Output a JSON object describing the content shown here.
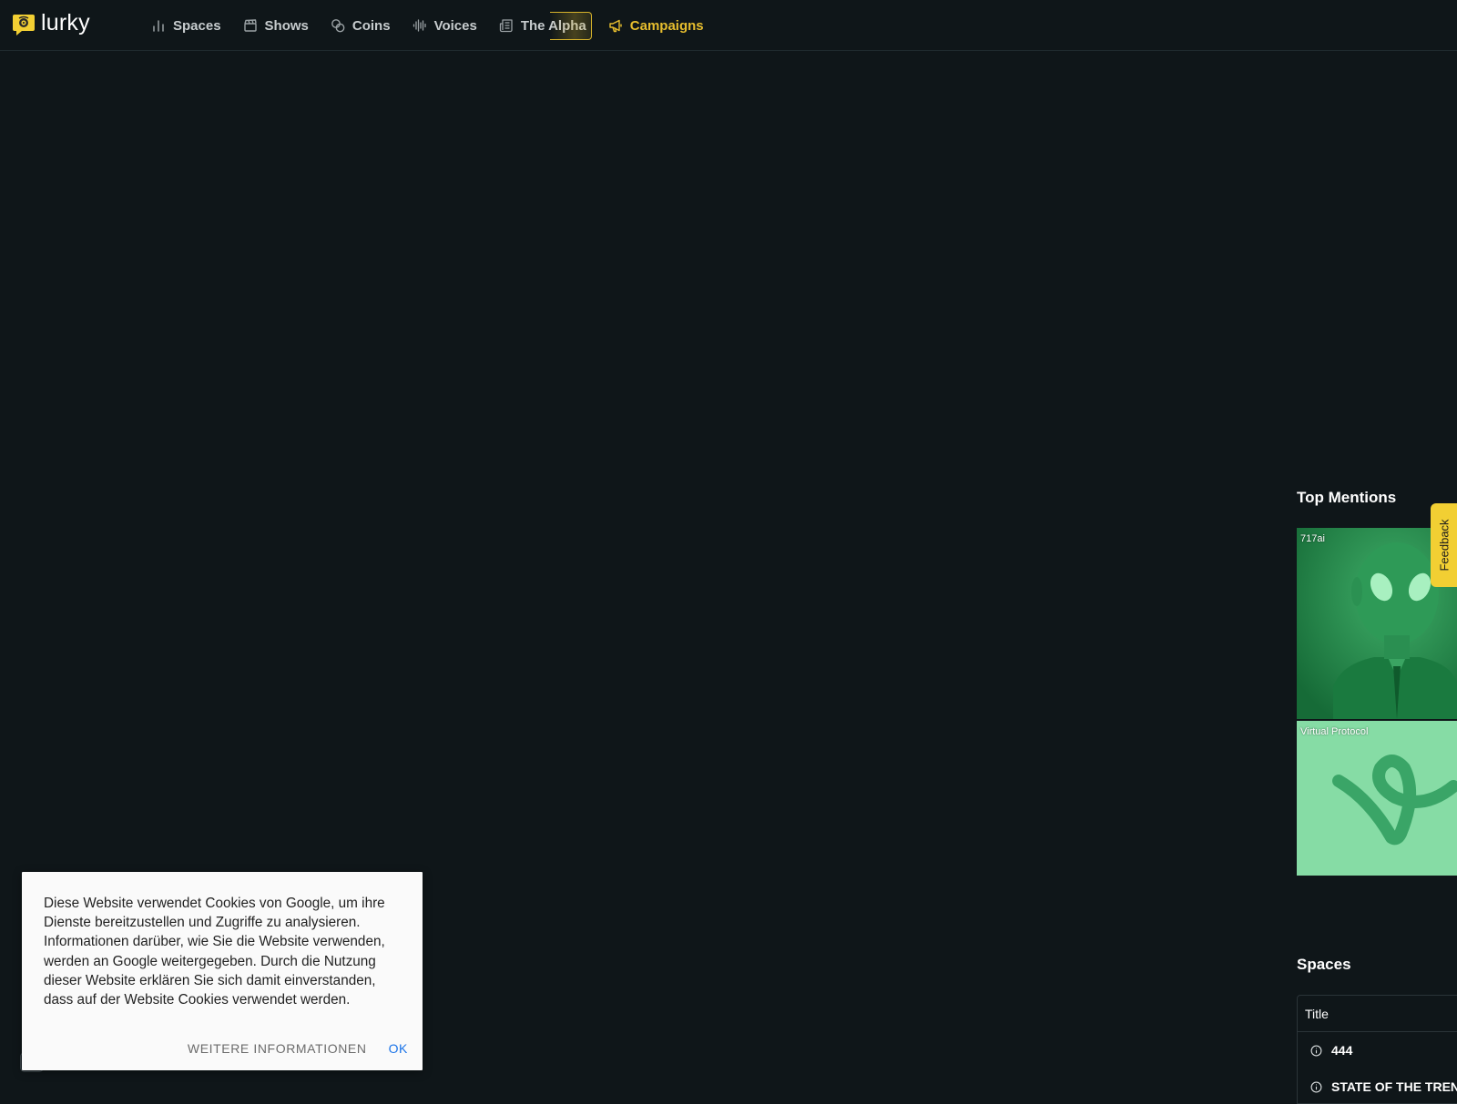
{
  "brand": {
    "name": "lurky",
    "color": "#f2cf33"
  },
  "nav": {
    "items": [
      {
        "label": "Spaces",
        "icon": "bar-chart-icon"
      },
      {
        "label": "Shows",
        "icon": "clapperboard-icon"
      },
      {
        "label": "Coins",
        "icon": "coins-icon"
      },
      {
        "label": "Voices",
        "icon": "audio-wave-icon"
      },
      {
        "label": "The Alpha",
        "icon": "newspaper-icon"
      },
      {
        "label": "Campaigns",
        "icon": "megaphone-icon",
        "active_color": "#e7be2e"
      }
    ]
  },
  "top_mentions": {
    "title": "Top Mentions",
    "items": [
      {
        "label": "717ai"
      },
      {
        "label": "Virtual Protocol"
      }
    ]
  },
  "spaces": {
    "title": "Spaces",
    "column_title": "Title",
    "rows": [
      {
        "title": "444"
      },
      {
        "title": "STATE OF THE TRENC"
      }
    ]
  },
  "feedback": {
    "label": "Feedback"
  },
  "cookie": {
    "text": "Diese Website verwendet Cookies von Google, um ihre Dienste bereitzustellen und Zugriffe zu analysieren. Informationen darüber, wie Sie die Website verwenden, werden an Google weitergegeben. Durch die Nutzung dieser Website erklären Sie sich damit einverstanden, dass auf der Website Cookies verwendet werden.",
    "more_label": "WEITERE INFORMATIONEN",
    "ok_label": "OK"
  }
}
